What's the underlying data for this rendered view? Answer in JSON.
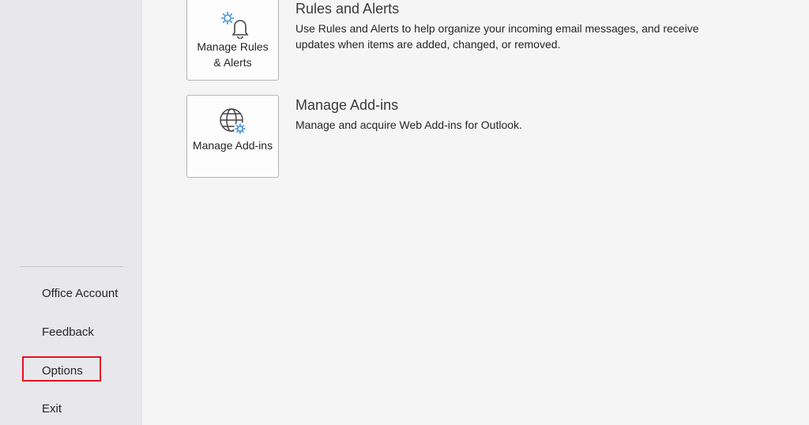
{
  "sidebar": {
    "items": [
      {
        "label": "Office Account"
      },
      {
        "label": "Feedback"
      },
      {
        "label": "Options"
      },
      {
        "label": "Exit"
      }
    ]
  },
  "main": {
    "sections": [
      {
        "button_label": "Manage Rules & Alerts",
        "title": "Rules and Alerts",
        "description": "Use Rules and Alerts to help organize your incoming email messages, and receive updates when items are added, changed, or removed.",
        "icon": "rules-alerts-icon"
      },
      {
        "button_label": "Manage Add-ins",
        "title": "Manage Add-ins",
        "description": "Manage and acquire Web Add-ins for Outlook.",
        "icon": "globe-gear-icon"
      }
    ]
  },
  "colors": {
    "highlight": "#e81123",
    "icon_accent": "#3c8fd6"
  }
}
